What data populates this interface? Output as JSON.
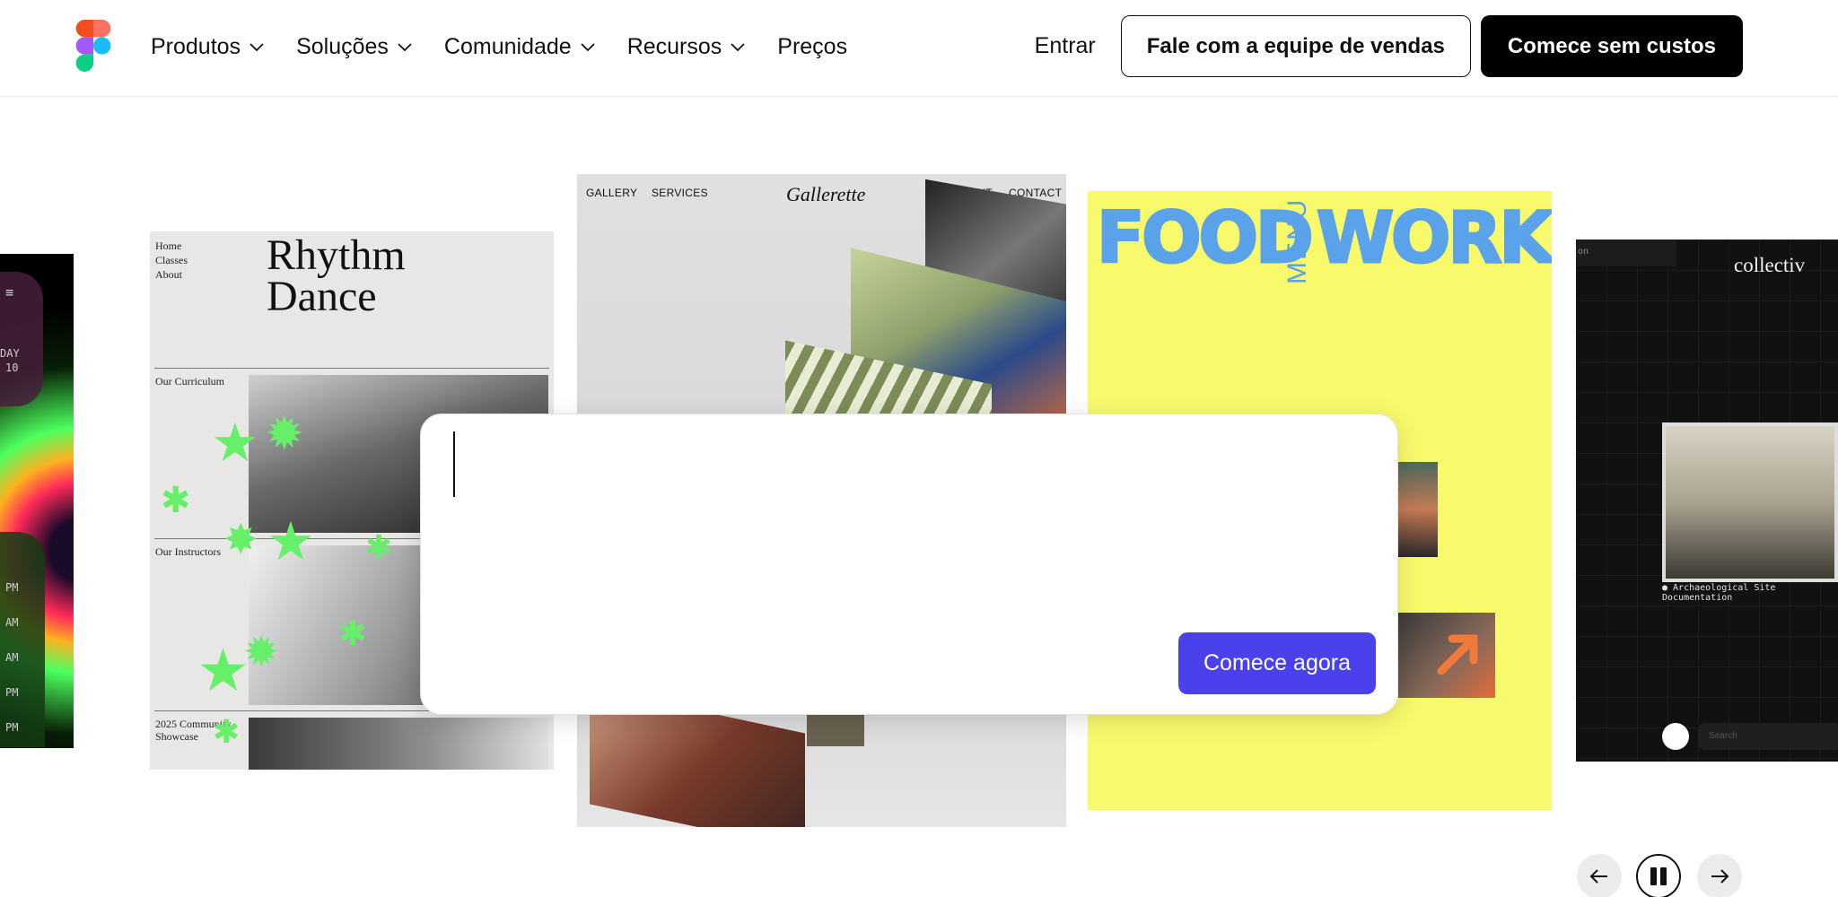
{
  "nav": {
    "items": [
      {
        "label": "Produtos",
        "dropdown": true
      },
      {
        "label": "Soluções",
        "dropdown": true
      },
      {
        "label": "Comunidade",
        "dropdown": true
      },
      {
        "label": "Recursos",
        "dropdown": true
      },
      {
        "label": "Preços",
        "dropdown": false
      }
    ],
    "signin": "Entrar",
    "sales_button": "Fale com a equipe de vendas",
    "cta_button": "Comece sem custos"
  },
  "cards": {
    "left_strip": {
      "labels": [
        "DAY",
        "10",
        "PM",
        "AM",
        "AM",
        "PM",
        "PM"
      ]
    },
    "dance": {
      "menu": [
        "Home",
        "Classes",
        "About"
      ],
      "title_line1": "Rhythm",
      "title_line2": "Dance",
      "sections": [
        "Our Curriculum",
        "Our Instructors",
        "2025 Community",
        "Showcase"
      ]
    },
    "gallery": {
      "nav_left_1": "GALLERY",
      "nav_left_2": "SERVICES",
      "title": "Gallerette",
      "nav_right_1": "ABOUT",
      "nav_right_2": "CONTACT"
    },
    "food": {
      "word1": "FOOD",
      "menu": "MENU",
      "word2": "WORKS"
    },
    "collectiv": {
      "tab": "on",
      "title": "collectiv",
      "caption": "● Archaeological Site Documentation",
      "search_placeholder": "Search"
    }
  },
  "prompt": {
    "value": "",
    "button": "Comece agora"
  },
  "carousel": {
    "prev": "←",
    "next": "→"
  },
  "colors": {
    "accent": "#4b41ec",
    "food_bg": "#f8fa6c",
    "food_text": "#5aa2ea",
    "star_green": "#66f06a"
  }
}
